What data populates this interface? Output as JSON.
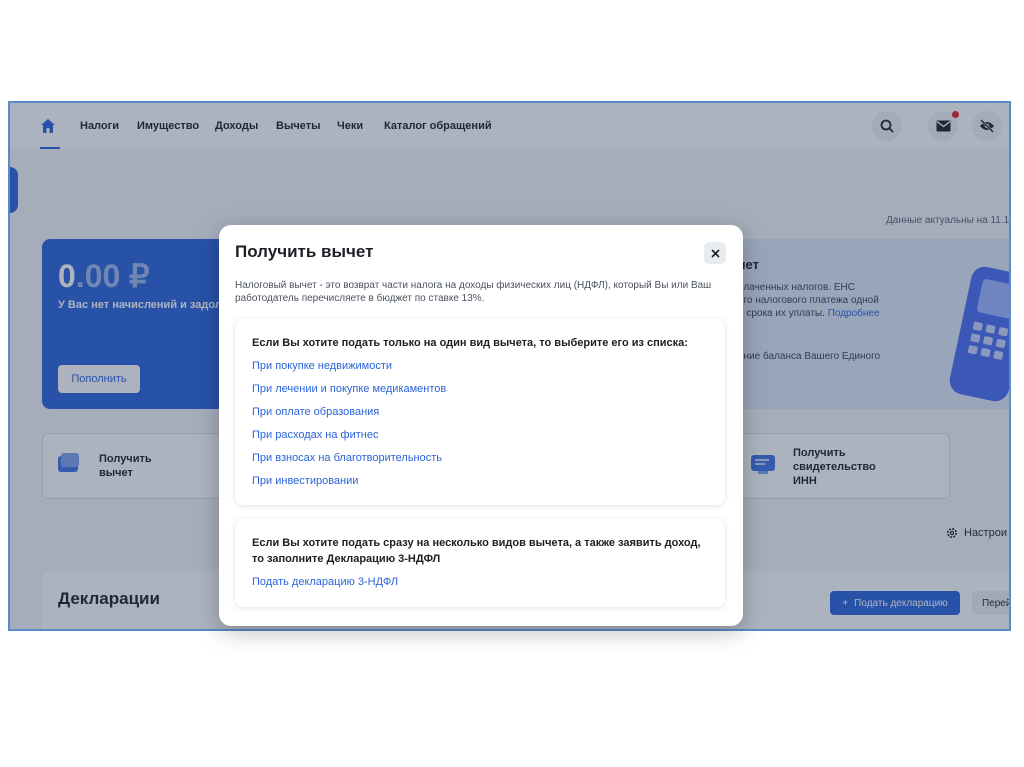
{
  "nav": {
    "items": [
      "Налоги",
      "Имущество",
      "Доходы",
      "Вычеты",
      "Чеки",
      "Каталог обращений"
    ]
  },
  "header": {
    "data_note": "Данные актуальны на 11.1"
  },
  "balance": {
    "amount_int": "0",
    "amount_dec": ".00 ₽",
    "note": "У Вас нет начислений и задол",
    "topup_label": "Пополнить"
  },
  "ens": {
    "title_fragment": "чет",
    "text_lines": [
      "плаченных налогов. ЕНС",
      "ого налогового платежа одной",
      "о срока их уплаты."
    ],
    "more_link": "Подробнее",
    "text2": "ение баланса Вашего Единого"
  },
  "actions": {
    "deduction_line1": "Получить",
    "deduction_line2": "вычет",
    "inn_line1": "Получить",
    "inn_line2": "свидетельство",
    "inn_line3": "ИНН"
  },
  "settings_label": "Настрои",
  "declarations": {
    "title": "Декларации",
    "submit_label": "Подать декларацию",
    "secondary_label": "Перей"
  },
  "modal": {
    "title": "Получить вычет",
    "description": "Налоговый вычет - это возврат части налога на доходы физических лиц (НДФЛ), который Вы или Ваш работодатель перечисляете в бюджет по ставке 13%.",
    "section1_heading": "Если Вы хотите подать только на один вид вычета, то выберите его из списка:",
    "options": [
      "При покупке недвижимости",
      "При лечении и покупке медикаментов",
      "При оплате образования",
      "При расходах на фитнес",
      "При взносах на благотворительность",
      "При инвестировании"
    ],
    "section2_heading": "Если Вы хотите подать сразу на несколько видов вычета, а также заявить доход, то заполните Декларацию 3-НДФЛ",
    "section2_link": "Подать декларацию 3-НДФЛ"
  },
  "colors": {
    "accent": "#2b63d9",
    "frame_border": "#5b8ac7",
    "notification": "#e0201b"
  }
}
